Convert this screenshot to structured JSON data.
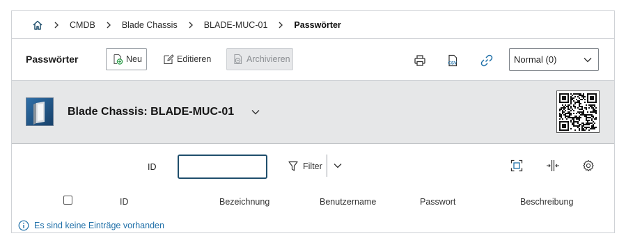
{
  "breadcrumb": {
    "home_icon": "home-icon",
    "items": [
      {
        "label": "CMDB"
      },
      {
        "label": "Blade Chassis"
      },
      {
        "label": "BLADE-MUC-01"
      },
      {
        "label": "Passwörter"
      }
    ]
  },
  "toolbar": {
    "title": "Passwörter",
    "new_label": "Neu",
    "edit_label": "Editieren",
    "archive_label": "Archivieren",
    "icons": [
      "printer-icon",
      "csv-export-icon",
      "link-icon"
    ],
    "view_select": {
      "value": "Normal (0)"
    }
  },
  "object": {
    "title": "Blade Chassis: BLADE-MUC-01"
  },
  "filter": {
    "id_label": "ID",
    "id_value": "",
    "filter_label": "Filter",
    "right_icons": [
      "fullscreen-icon",
      "column-resize-icon",
      "settings-gear-icon"
    ]
  },
  "table": {
    "columns": [
      "ID",
      "Bezeichnung",
      "Benutzername",
      "Passwort",
      "Beschreibung"
    ],
    "rows": []
  },
  "empty_message": "Es sind keine Einträge vorhanden",
  "colors": {
    "accent": "#1f4e6c",
    "link": "#1e6fa8",
    "header_bg": "#e6e7e8",
    "new_icon_green": "#2e9e4a"
  }
}
